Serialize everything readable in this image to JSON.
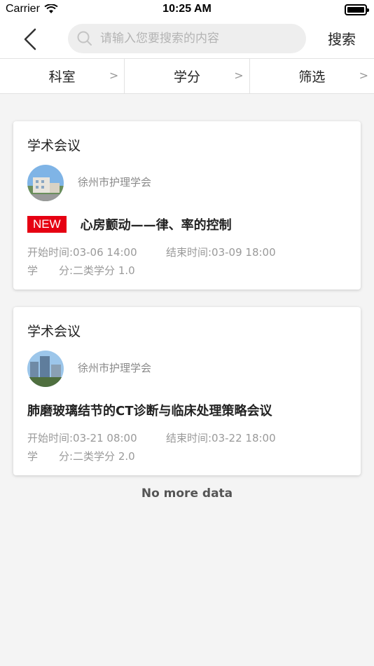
{
  "status_bar": {
    "carrier": "Carrier",
    "time": "10:25 AM"
  },
  "nav": {
    "search_placeholder": "请输入您要搜索的内容",
    "search_value": "",
    "search_button": "搜索"
  },
  "filters": [
    {
      "label": "科室",
      "arrow": ">"
    },
    {
      "label": "学分",
      "arrow": ">"
    },
    {
      "label": "筛选",
      "arrow": ">"
    }
  ],
  "cards": [
    {
      "type": "学术会议",
      "org": "徐州市护理学会",
      "badge": "NEW",
      "title": "心房颤动——律、率的控制",
      "start": "开始时间:03-06 14:00",
      "end": "结束时间:03-09 18:00",
      "credit": "学　　分:二类学分 1.0"
    },
    {
      "type": "学术会议",
      "org": "徐州市护理学会",
      "title": "肺磨玻璃结节的CT诊断与临床处理策略会议",
      "start": "开始时间:03-21 08:00",
      "end": "结束时间:03-22 18:00",
      "credit": "学　　分:二类学分 2.0"
    }
  ],
  "footer": {
    "no_more": "No more data"
  },
  "colors": {
    "badge": "#e60012",
    "muted_text": "#9a9a9a",
    "background": "#f4f4f4"
  },
  "icons": [
    "wifi-icon",
    "battery-icon",
    "back-chevron-icon",
    "search-icon",
    "chevron-right-icon",
    "org-avatar-image"
  ]
}
